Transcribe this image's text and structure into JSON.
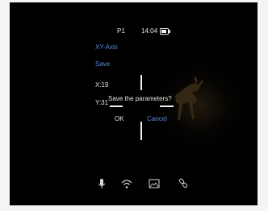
{
  "status_bar": {
    "profile": "P1",
    "time": "14:04",
    "battery_icon": "battery-icon"
  },
  "menu": {
    "xy_axis_label": "XY-Axis",
    "save_label": "Save"
  },
  "coordinates": {
    "x_label": "X:19",
    "y_label": "Y:31"
  },
  "dialog": {
    "message": "Save the parameters?",
    "ok_label": "OK",
    "cancel_label": "Cancel"
  },
  "bottom_bar": {
    "icons": [
      "microphone-icon",
      "wifi-icon",
      "image-mode-icon",
      "link-icon"
    ]
  },
  "colors": {
    "accent": "#5d89d8",
    "text": "#e6e6e6",
    "background": "#000000"
  }
}
